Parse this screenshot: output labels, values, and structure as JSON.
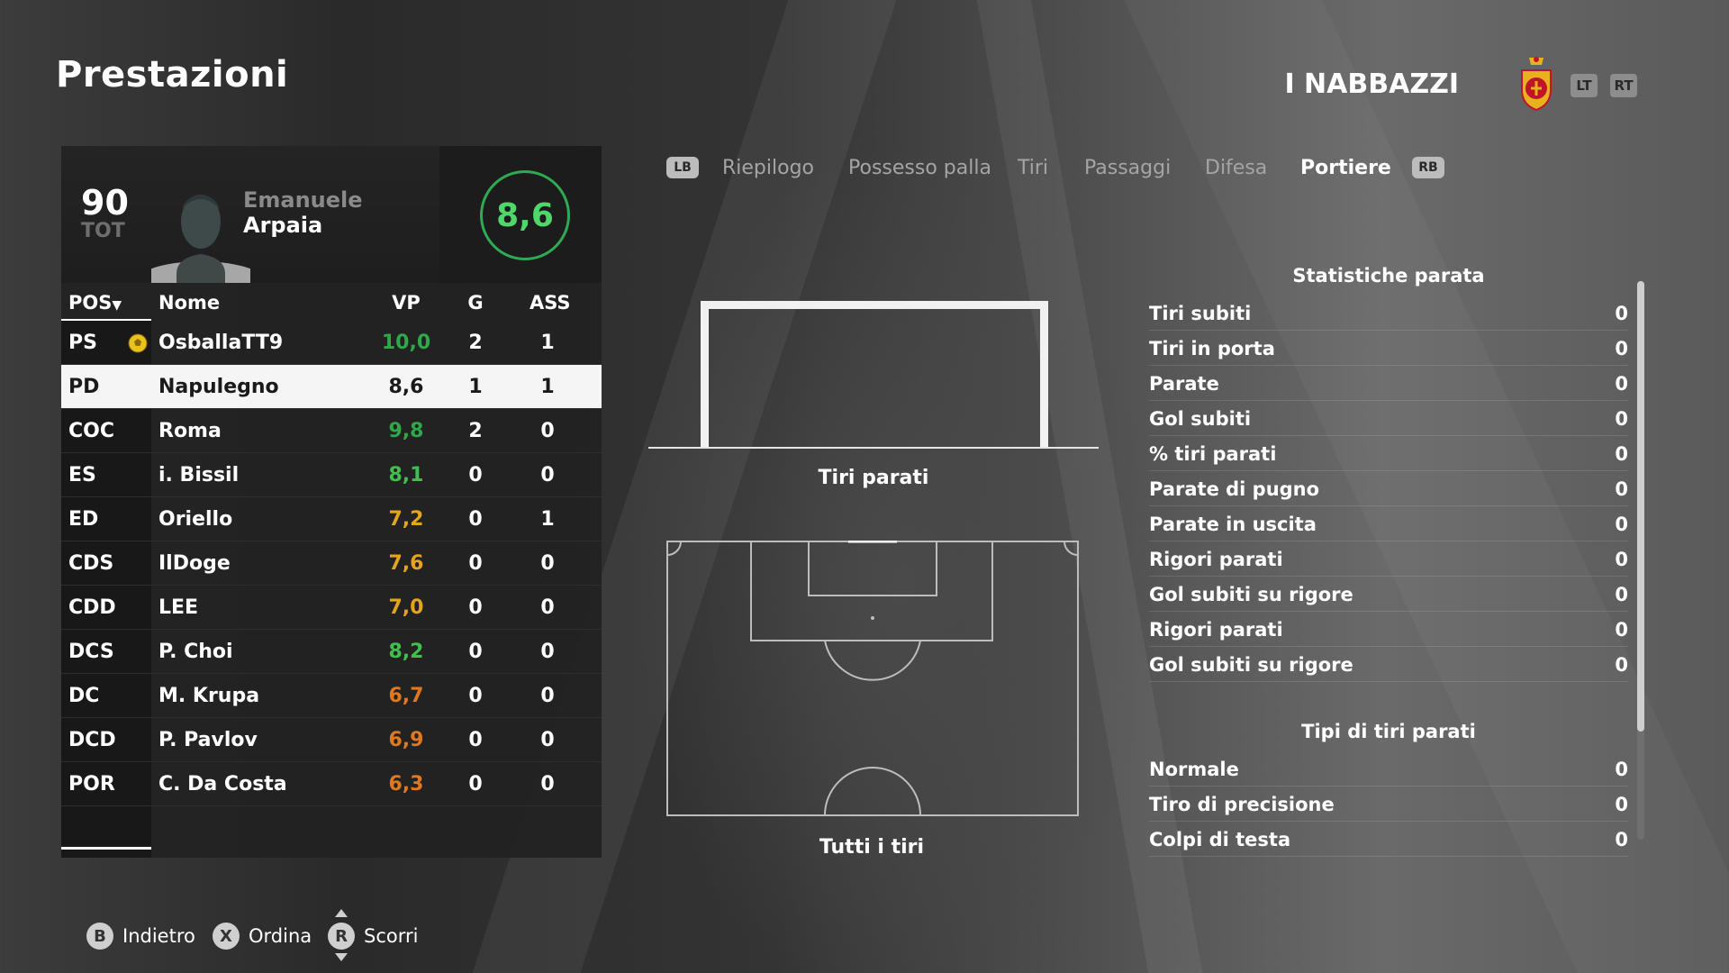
{
  "header": {
    "title": "Prestazioni",
    "team_name": "I NABBAZZI",
    "crest_icon": "club-crest-icon",
    "lt_label": "LT",
    "rt_label": "RT"
  },
  "player_card": {
    "overall": "90",
    "overall_label": "TOT",
    "first_name": "Emanuele",
    "last_name": "Arpaia",
    "rating": "8,6",
    "rating_color": "#2faa52"
  },
  "table": {
    "headers": {
      "pos": "POS",
      "name": "Nome",
      "vp": "VP",
      "g": "G",
      "ass": "ASS"
    },
    "rows": [
      {
        "pos": "PS",
        "name": "OsballaTT9",
        "vp": "10,0",
        "g": "2",
        "ass": "1",
        "vp_color": "#2fa84a",
        "mvp": true
      },
      {
        "pos": "PD",
        "name": "Napulegno",
        "vp": "8,6",
        "g": "1",
        "ass": "1",
        "vp_color": "#1a1a1a",
        "selected": true
      },
      {
        "pos": "COC",
        "name": "Roma",
        "vp": "9,8",
        "g": "2",
        "ass": "0",
        "vp_color": "#2fa84a"
      },
      {
        "pos": "ES",
        "name": "i. Bissil",
        "vp": "8,1",
        "g": "0",
        "ass": "0",
        "vp_color": "#3fbf4f"
      },
      {
        "pos": "ED",
        "name": "Oriello",
        "vp": "7,2",
        "g": "0",
        "ass": "1",
        "vp_color": "#e3a51e"
      },
      {
        "pos": "CDS",
        "name": "IlDoge",
        "vp": "7,6",
        "g": "0",
        "ass": "0",
        "vp_color": "#e3a51e"
      },
      {
        "pos": "CDD",
        "name": "LEE",
        "vp": "7,0",
        "g": "0",
        "ass": "0",
        "vp_color": "#e3a51e"
      },
      {
        "pos": "DCS",
        "name": "P. Choi",
        "vp": "8,2",
        "g": "0",
        "ass": "0",
        "vp_color": "#3fbf4f"
      },
      {
        "pos": "DC",
        "name": "M. Krupa",
        "vp": "6,7",
        "g": "0",
        "ass": "0",
        "vp_color": "#e0781f"
      },
      {
        "pos": "DCD",
        "name": "P. Pavlov",
        "vp": "6,9",
        "g": "0",
        "ass": "0",
        "vp_color": "#e0781f"
      },
      {
        "pos": "POR",
        "name": "C. Da Costa",
        "vp": "6,3",
        "g": "0",
        "ass": "0",
        "vp_color": "#e0781f"
      }
    ]
  },
  "tabs": {
    "lb": "LB",
    "rb": "RB",
    "items": [
      "Riepilogo",
      "Possesso palla",
      "Tiri",
      "Passaggi",
      "Difesa",
      "Portiere"
    ],
    "active": "Portiere"
  },
  "charts": {
    "goal_caption": "Tiri parati",
    "pitch_caption": "Tutti i tiri"
  },
  "stats": {
    "saves_title": "Statistiche parata",
    "saves": [
      {
        "label": "Tiri subiti",
        "value": "0"
      },
      {
        "label": "Tiri in porta",
        "value": "0"
      },
      {
        "label": "Parate",
        "value": "0"
      },
      {
        "label": "Gol subiti",
        "value": "0"
      },
      {
        "label": "% tiri parati",
        "value": "0"
      },
      {
        "label": "Parate di pugno",
        "value": "0"
      },
      {
        "label": "Parate in uscita",
        "value": "0"
      },
      {
        "label": "Rigori parati",
        "value": "0"
      },
      {
        "label": "Gol subiti su rigore",
        "value": "0"
      },
      {
        "label": "Rigori parati",
        "value": "0"
      },
      {
        "label": "Gol subiti su rigore",
        "value": "0"
      }
    ],
    "types_title": "Tipi di tiri parati",
    "types": [
      {
        "label": "Normale",
        "value": "0"
      },
      {
        "label": "Tiro di precisione",
        "value": "0"
      },
      {
        "label": "Colpi di testa",
        "value": "0"
      }
    ]
  },
  "footer": {
    "back": {
      "button": "B",
      "label": "Indietro"
    },
    "sort": {
      "button": "X",
      "label": "Ordina"
    },
    "scroll": {
      "button": "R",
      "label": "Scorri"
    }
  }
}
